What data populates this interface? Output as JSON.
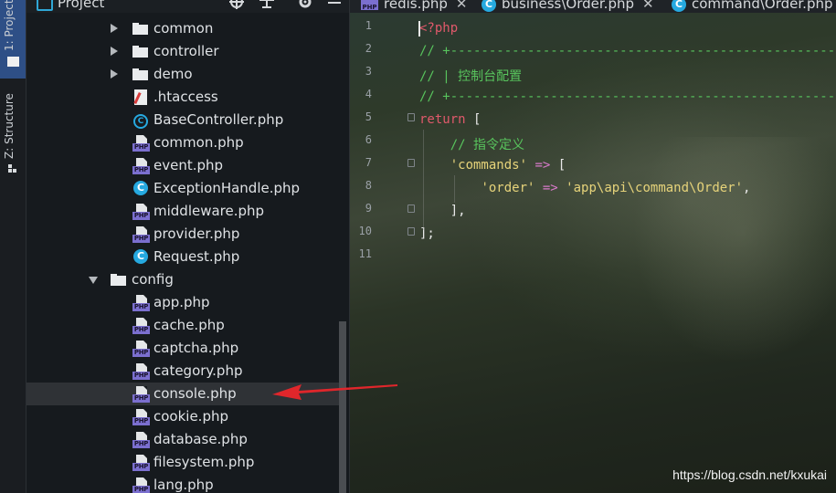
{
  "side_strip": {
    "project_tab": "1: Project",
    "structure_tab": "Z: Structure"
  },
  "project_panel": {
    "title": "Project",
    "tree": [
      {
        "label": "common",
        "type": "folder",
        "expanded": false,
        "depth": 1
      },
      {
        "label": "controller",
        "type": "folder",
        "expanded": false,
        "depth": 1
      },
      {
        "label": "demo",
        "type": "folder",
        "expanded": false,
        "depth": 1
      },
      {
        "label": ".htaccess",
        "type": "htaccess",
        "depth": 1
      },
      {
        "label": "BaseController.php",
        "type": "class-abstract",
        "depth": 1
      },
      {
        "label": "common.php",
        "type": "php",
        "depth": 1
      },
      {
        "label": "event.php",
        "type": "php",
        "depth": 1
      },
      {
        "label": "ExceptionHandle.php",
        "type": "class",
        "depth": 1
      },
      {
        "label": "middleware.php",
        "type": "php",
        "depth": 1
      },
      {
        "label": "provider.php",
        "type": "php",
        "depth": 1
      },
      {
        "label": "Request.php",
        "type": "class",
        "depth": 1
      },
      {
        "label": "config",
        "type": "folder",
        "expanded": true,
        "depth": 0
      },
      {
        "label": "app.php",
        "type": "php",
        "depth": 1
      },
      {
        "label": "cache.php",
        "type": "php",
        "depth": 1
      },
      {
        "label": "captcha.php",
        "type": "php",
        "depth": 1
      },
      {
        "label": "category.php",
        "type": "php",
        "depth": 1
      },
      {
        "label": "console.php",
        "type": "php",
        "depth": 1,
        "selected": true
      },
      {
        "label": "cookie.php",
        "type": "php",
        "depth": 1
      },
      {
        "label": "database.php",
        "type": "php",
        "depth": 1
      },
      {
        "label": "filesystem.php",
        "type": "php",
        "depth": 1
      },
      {
        "label": "lang.php",
        "type": "php",
        "depth": 1
      }
    ]
  },
  "editor": {
    "tabs": [
      {
        "label": "redis.php",
        "icon": "php-file-icon"
      },
      {
        "label": "business\\Order.php",
        "icon": "class-icon"
      },
      {
        "label": "command\\Order.php",
        "icon": "class-icon"
      }
    ],
    "lines": [
      {
        "num": "1",
        "tokens": [
          {
            "t": "<?php",
            "c": "tag"
          }
        ]
      },
      {
        "num": "2",
        "tokens": [
          {
            "t": "// +----------------------------------------------------------------------",
            "c": "cmt"
          }
        ]
      },
      {
        "num": "3",
        "tokens": [
          {
            "t": "// | 控制台配置",
            "c": "cmt"
          }
        ]
      },
      {
        "num": "4",
        "tokens": [
          {
            "t": "// +----------------------------------------------------------------------",
            "c": "cmt"
          }
        ]
      },
      {
        "num": "5",
        "tokens": [
          {
            "t": "return",
            "c": "kw"
          },
          {
            "t": " [",
            "c": "pun"
          }
        ]
      },
      {
        "num": "6",
        "tokens": [
          {
            "t": "    // 指令定义",
            "c": "cmt"
          }
        ]
      },
      {
        "num": "7",
        "tokens": [
          {
            "t": "    ",
            "c": "pun"
          },
          {
            "t": "'commands'",
            "c": "str"
          },
          {
            "t": " => ",
            "c": "op"
          },
          {
            "t": "[",
            "c": "pun"
          }
        ]
      },
      {
        "num": "8",
        "tokens": [
          {
            "t": "        ",
            "c": "pun"
          },
          {
            "t": "'order'",
            "c": "str"
          },
          {
            "t": " => ",
            "c": "op"
          },
          {
            "t": "'app\\api\\command\\Order'",
            "c": "str"
          },
          {
            "t": ",",
            "c": "pun"
          }
        ]
      },
      {
        "num": "9",
        "tokens": [
          {
            "t": "    ],",
            "c": "pun"
          }
        ]
      },
      {
        "num": "10",
        "tokens": [
          {
            "t": "];",
            "c": "pun"
          }
        ]
      },
      {
        "num": "11",
        "tokens": []
      }
    ]
  },
  "watermark": "https://blog.csdn.net/kxukai",
  "colors": {
    "selection": "#2f3236",
    "accent_blue": "#2e4f86",
    "arrow_red": "#e0262b"
  }
}
